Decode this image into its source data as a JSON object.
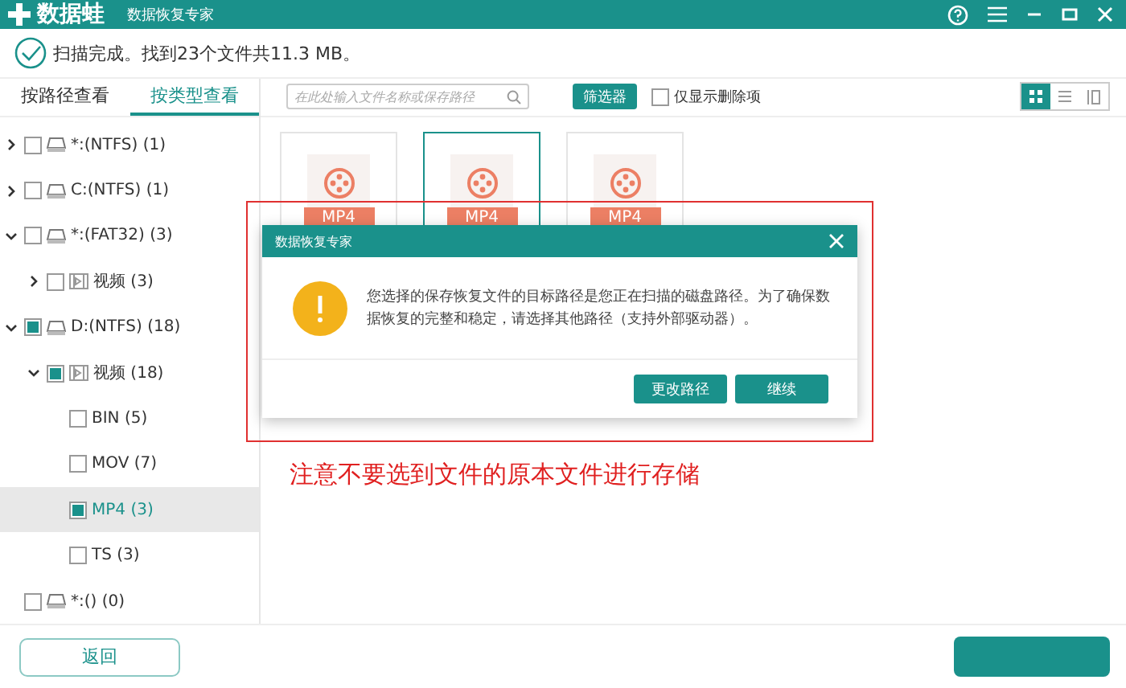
{
  "window": {
    "logo": "数据蛙",
    "title": "数据恢复专家"
  },
  "status": "扫描完成。找到23个文件共11.3 MB。",
  "view_tabs": [
    {
      "label": "按路径查看",
      "selected": false
    },
    {
      "label": "按类型查看",
      "selected": true
    }
  ],
  "tree": [
    {
      "kind": "drive",
      "label": "*:(NTFS) (1)",
      "checked": false,
      "expanded": false,
      "selected": false
    },
    {
      "kind": "drive",
      "label": "C:(NTFS) (1)",
      "checked": false,
      "expanded": false,
      "selected": false
    },
    {
      "kind": "drive",
      "label": "*:(FAT32) (3)",
      "checked": false,
      "expanded": true,
      "selected": false,
      "children": [
        {
          "kind": "folder",
          "label": "视频 (3)",
          "checked": false,
          "expanded": false,
          "selected": false
        }
      ]
    },
    {
      "kind": "drive",
      "label": "D:(NTFS) (18)",
      "checked": true,
      "expanded": true,
      "selected": false,
      "children": [
        {
          "kind": "folder",
          "label": "视频 (18)",
          "checked": true,
          "expanded": true,
          "selected": false,
          "children": [
            {
              "label": "BIN (5)",
              "checked": false,
              "selected": false
            },
            {
              "label": "MOV (7)",
              "checked": false,
              "selected": false
            },
            {
              "label": "MP4 (3)",
              "checked": true,
              "selected": true
            },
            {
              "label": "TS (3)",
              "checked": false,
              "selected": false
            }
          ]
        }
      ]
    },
    {
      "kind": "drive",
      "label": "*:() (0)",
      "checked": false,
      "selected": false
    }
  ],
  "toolbar": {
    "search": {
      "placeholder": "在此处输入文件名称或保存路径"
    },
    "filter_button": "筛选器",
    "deleted_only": {
      "label": "仅显示删除项",
      "checked": false
    },
    "views": [
      {
        "kind": "grid",
        "selected": true
      },
      {
        "kind": "list",
        "selected": false
      },
      {
        "kind": "preview",
        "selected": false
      }
    ]
  },
  "files": [
    {
      "ext": "MP4",
      "selected": false
    },
    {
      "ext": "MP4",
      "selected": true
    },
    {
      "ext": "MP4",
      "selected": false
    }
  ],
  "dialog": {
    "title": "数据恢复专家",
    "message": "您选择的保存恢复文件的目标路径是您正在扫描的磁盘路径。为了确保数据恢复的完整和稳定，请选择其他路径（支持外部驱动器）。",
    "buttons": [
      "更改路径",
      "继续"
    ]
  },
  "annotation": "注意不要选到文件的原本文件进行存储",
  "back_button": "返回"
}
